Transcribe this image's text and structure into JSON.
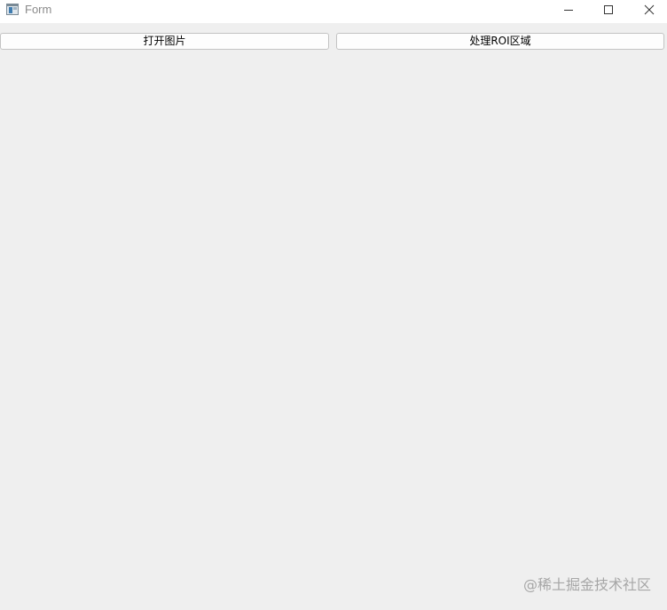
{
  "window": {
    "title": "Form",
    "controls": {
      "minimize": "minimize-icon",
      "maximize": "maximize-icon",
      "close": "close-icon"
    }
  },
  "form": {
    "open_image_label": "打开图片",
    "process_roi_label": "处理ROI区域"
  },
  "watermark": {
    "text": "@稀土掘金技术社区"
  },
  "colors": {
    "background": "#efefef",
    "titlebar": "#ffffff",
    "button_border": "#c3c3c3"
  }
}
